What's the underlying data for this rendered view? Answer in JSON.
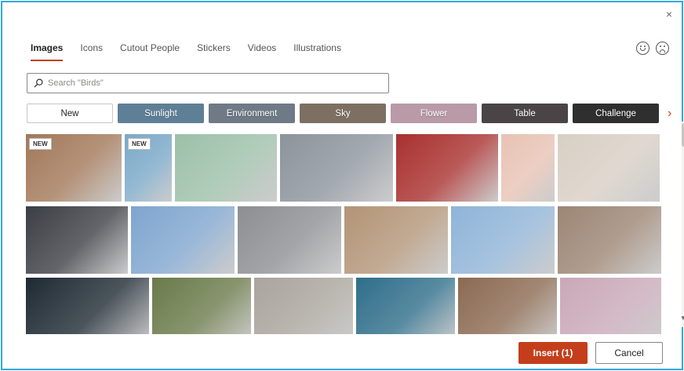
{
  "dialog": {
    "close_label": "×"
  },
  "tabs": [
    {
      "label": "Images",
      "active": true
    },
    {
      "label": "Icons"
    },
    {
      "label": "Cutout People"
    },
    {
      "label": "Stickers"
    },
    {
      "label": "Videos"
    },
    {
      "label": "Illustrations"
    }
  ],
  "feedback": {
    "happy_icon": "smiley-icon",
    "sad_icon": "frown-icon"
  },
  "search": {
    "placeholder": "Search \"Birds\"",
    "value": ""
  },
  "categories": [
    {
      "label": "New",
      "style": "plain"
    },
    {
      "label": "Sunlight",
      "color": "#5e7f96"
    },
    {
      "label": "Environment",
      "color": "#6f7a86"
    },
    {
      "label": "Sky",
      "color": "#7d6f62"
    },
    {
      "label": "Flower",
      "color": "#b99aa6"
    },
    {
      "label": "Table",
      "color": "#4a4446"
    },
    {
      "label": "Challenge",
      "color": "#2f2f30"
    }
  ],
  "images": {
    "new_badge": "NEW",
    "rows": [
      [
        {
          "name": "palette-painting-photo",
          "badge": true,
          "color": "#a27859"
        },
        {
          "name": "paper-pattern-photo",
          "badge": true,
          "color": "#7aa8c8"
        },
        {
          "name": "paper-family-photo",
          "color": "#9cc0a8"
        },
        {
          "name": "balance-spheres-photo",
          "color": "#8b939c"
        },
        {
          "name": "woman-red-wall-photo",
          "color": "#a8302e"
        },
        {
          "name": "cactus-photo",
          "color": "#e8c2b4"
        },
        {
          "name": "cafe-interior-photo",
          "color": "#d8cfc4"
        }
      ],
      [
        {
          "name": "barber-photo",
          "color": "#3b3e44"
        },
        {
          "name": "snowy-mountain-photo",
          "color": "#7fa5cf"
        },
        {
          "name": "spiral-staircase-photo",
          "color": "#8c8e92"
        },
        {
          "name": "warehouse-worker-photo",
          "color": "#b29476"
        },
        {
          "name": "golden-gate-bridge-photo",
          "color": "#8fb4d8"
        },
        {
          "name": "coastline-aerial-photo",
          "color": "#9c8574"
        }
      ],
      [
        {
          "name": "abstract-fluid-photo",
          "color": "#1e2a33"
        },
        {
          "name": "gardener-photo",
          "color": "#6a7a4a"
        },
        {
          "name": "wood-grain-photo",
          "color": "#a9a49c"
        },
        {
          "name": "plumeria-flowers-photo",
          "color": "#2f6e8a"
        },
        {
          "name": "carrots-photo",
          "color": "#8b6a52"
        },
        {
          "name": "industrial-crane-photo",
          "color": "#c9a8b8"
        }
      ]
    ]
  },
  "buttons": {
    "insert": "Insert (1)",
    "cancel": "Cancel"
  },
  "accent_color": "#c43e1c"
}
